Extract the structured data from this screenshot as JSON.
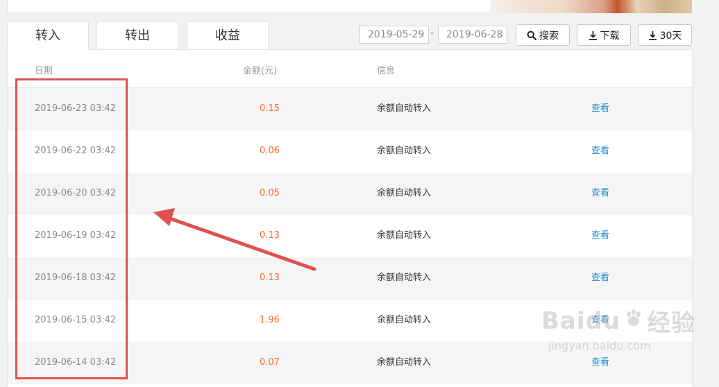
{
  "tabs": [
    {
      "label": "转入"
    },
    {
      "label": "转出"
    },
    {
      "label": "收益"
    }
  ],
  "filter": {
    "start_date": "2019-05-29",
    "separator": "-",
    "end_date": "2019-06-28",
    "search_label": "搜索",
    "download_label": "下载",
    "days30_label": "30天"
  },
  "table": {
    "headers": {
      "date": "日期",
      "amount": "金额(元)",
      "info": "信息"
    },
    "rows": [
      {
        "date": "2019-06-23 03:42",
        "amount": "0.15",
        "info": "余额自动转入",
        "action": "查看"
      },
      {
        "date": "2019-06-22 03:42",
        "amount": "0.06",
        "info": "余额自动转入",
        "action": "查看"
      },
      {
        "date": "2019-06-20 03:42",
        "amount": "0.05",
        "info": "余额自动转入",
        "action": "查看"
      },
      {
        "date": "2019-06-19 03:42",
        "amount": "0.13",
        "info": "余额自动转入",
        "action": "查看"
      },
      {
        "date": "2019-06-18 03:42",
        "amount": "0.13",
        "info": "余额自动转入",
        "action": "查看"
      },
      {
        "date": "2019-06-15 03:42",
        "amount": "1.96",
        "info": "余额自动转入",
        "action": "查看"
      },
      {
        "date": "2019-06-14 03:42",
        "amount": "0.07",
        "info": "余额自动转入",
        "action": "查看"
      }
    ]
  },
  "watermark": {
    "brand": "Baidu",
    "text": "经验",
    "url": "jingyan.baidu.com"
  },
  "colors": {
    "amount": "#ff6a24",
    "link": "#2391d8",
    "annotation": "#e05050"
  }
}
